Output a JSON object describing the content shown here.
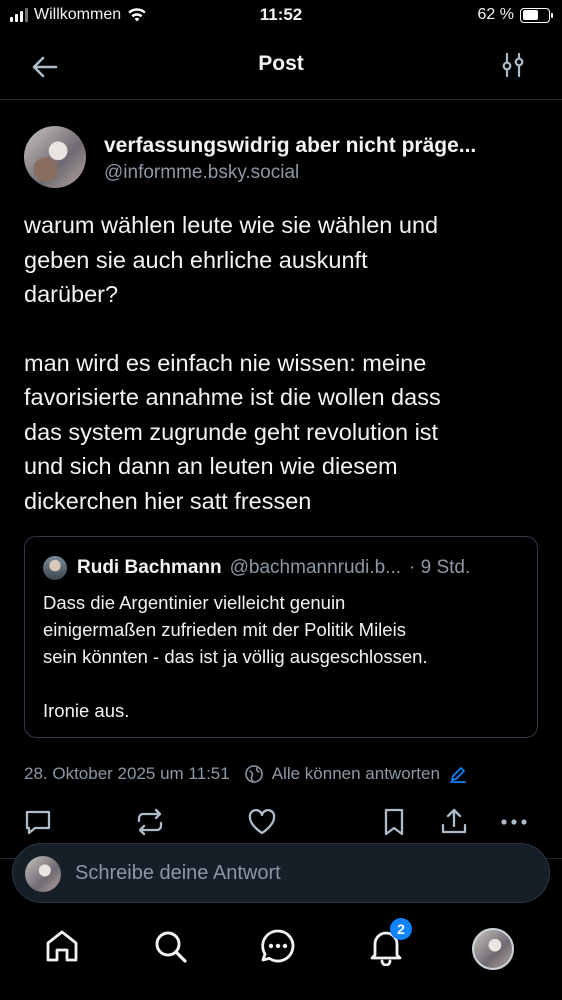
{
  "status_bar": {
    "carrier": "Willkommen",
    "time": "11:52",
    "battery_percent": "62 %",
    "battery_level": 0.62,
    "icons": [
      "signal-icon",
      "wifi-icon",
      "battery-icon"
    ]
  },
  "header": {
    "title": "Post",
    "back_icon": "arrow-left-icon",
    "settings_icon": "sliders-icon"
  },
  "post": {
    "author_name": "verfassungswidrig aber nicht präge...",
    "author_handle": "@informme.bsky.social",
    "paragraphs": [
      "warum wählen leute wie sie wählen und\ngeben sie auch ehrliche auskunft\ndarüber?",
      "man wird es einfach nie wissen: meine\nfavorisierte annahme ist die wollen dass\ndas system zugrunde geht revolution ist\nund sich dann an leuten wie diesem\ndickerchen hier satt fressen"
    ],
    "quote": {
      "author_name": "Rudi Bachmann",
      "author_handle": "@bachmannrudi.b...",
      "time": "· 9 Std.",
      "paragraphs": [
        "Dass die Argentinier vielleicht genuin\neinigermaßen zufrieden mit der Politik Mileis\nsein könnten - das ist ja völlig ausgeschlossen.",
        "Ironie aus."
      ]
    },
    "date": "28. Oktober 2025 um 11:51",
    "reply_setting": "Alle können antworten"
  },
  "actions": [
    "reply-icon",
    "repost-icon",
    "like-icon",
    "bookmark-icon",
    "share-icon",
    "more-icon"
  ],
  "composer": {
    "placeholder": "Schreibe deine Antwort"
  },
  "tabbar": {
    "items": [
      "home-icon",
      "search-icon",
      "chat-icon",
      "notifications-icon",
      "profile-avatar"
    ],
    "notification_badge": "2"
  },
  "colors": {
    "background": "#000000",
    "text": "#f1f3f5",
    "muted": "#8b98a5",
    "border": "#2e3a48",
    "accent": "#1083fe"
  }
}
